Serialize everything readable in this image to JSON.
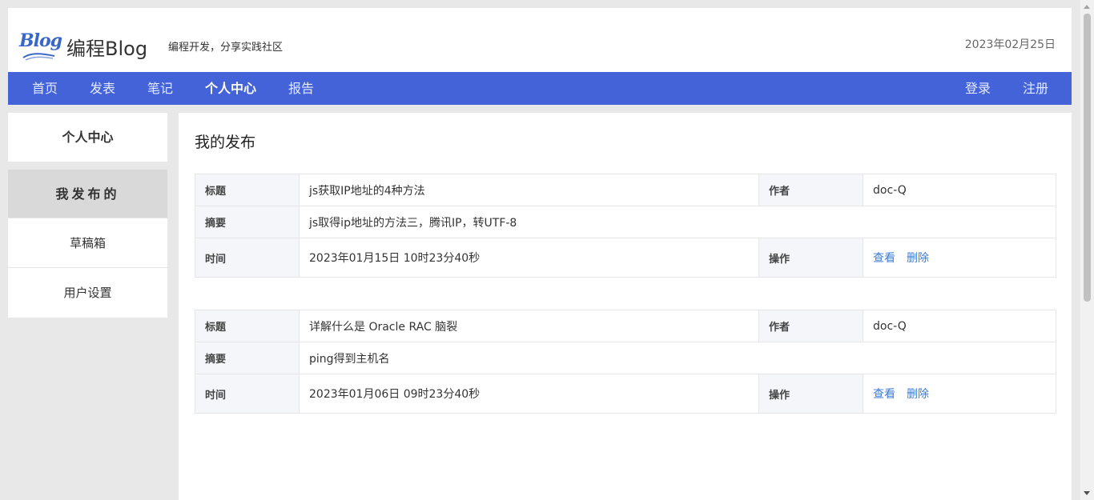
{
  "header": {
    "logo_text": "Blog",
    "site_name": "编程Blog",
    "slogan": "编程开发，分享实践社区",
    "date": "2023年02月25日"
  },
  "nav": {
    "items": [
      "首页",
      "发表",
      "笔记",
      "个人中心",
      "报告"
    ],
    "active": "个人中心",
    "login": "登录",
    "register": "注册"
  },
  "sidebar": {
    "title": "个人中心",
    "items": [
      "我发布的",
      "草稿箱",
      "用户设置"
    ],
    "active": "我发布的"
  },
  "main": {
    "title": "我的发布",
    "labels": {
      "title": "标题",
      "author": "作者",
      "summary": "摘要",
      "time": "时间",
      "actions": "操作",
      "view": "查看",
      "delete": "删除"
    },
    "posts": [
      {
        "title": "js获取IP地址的4种方法",
        "author": "doc-Q",
        "summary": "js取得ip地址的方法三，腾讯IP，转UTF-8",
        "time": "2023年01月15日 10时23分40秒"
      },
      {
        "title": "详解什么是 Oracle RAC 脑裂",
        "author": "doc-Q",
        "summary": "ping得到主机名",
        "time": "2023年01月06日 09时23分40秒"
      }
    ]
  },
  "colors": {
    "nav_bg": "#4463d9",
    "link": "#3a7bd5",
    "sidebar_active_bg": "#d9d9d9"
  }
}
